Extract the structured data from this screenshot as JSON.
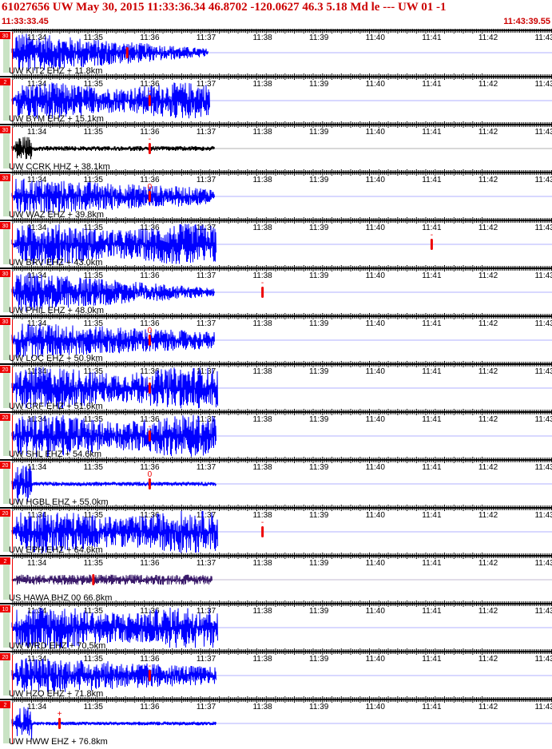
{
  "header": {
    "title": "61027656 UW May 30, 2015 11:33:36.34   46.8702 -120.0627 46.3 5.18 Md le --- UW 01  -1",
    "start_time": "11:33:33.45",
    "end_time": "11:43:39.55"
  },
  "colors": {
    "text": "#cc0000",
    "trace": "#0000ff",
    "trace_dark": "#000000",
    "trace_purple": "#3a1a6a",
    "pick": "#ee0000",
    "axis": "#000000",
    "grid_label": "#000000",
    "band": "#c9e3c4"
  },
  "chart_data": {
    "type": "seismogram",
    "time_range": [
      "11:33:33.45",
      "11:43:39.55"
    ],
    "time_tick_labels": [
      "11:34",
      "11:35",
      "11:36",
      "11:37",
      "11:38",
      "11:39",
      "11:40",
      "11:41",
      "11:42",
      "11:43"
    ],
    "traces": [
      {
        "label": "UW KIT2 EHZ + 11.8km",
        "scale": "30",
        "color": "blue",
        "signal_end": "11:37",
        "pick_time": "11:35.6",
        "pick_mark": ""
      },
      {
        "label": "UW BYM EHZ + 15.1km",
        "scale": "2",
        "color": "blue",
        "signal_end": "11:37",
        "pick_time": "11:36",
        "pick_mark": "-"
      },
      {
        "label": "UW CCRK HHZ + 38.1km",
        "scale": "30",
        "color": "black",
        "signal_end": "11:37",
        "pick_time": "11:36",
        "pick_mark": "-"
      },
      {
        "label": "UW WAZ EHZ + 39.8km",
        "scale": "30",
        "color": "blue",
        "signal_end": "11:37",
        "pick_time": "11:36",
        "pick_mark": "0"
      },
      {
        "label": "UW BRV EHZ + 43.0km",
        "scale": "30",
        "color": "blue",
        "signal_end": "11:37",
        "pick_time": "11:41",
        "pick_mark": "-"
      },
      {
        "label": "UW PHIL EHZ + 48.0km",
        "scale": "30",
        "color": "blue",
        "signal_end": "11:37",
        "pick_time": "11:38",
        "pick_mark": "-"
      },
      {
        "label": "UW LOC EHZ + 50.9km",
        "scale": "30",
        "color": "blue",
        "signal_end": "11:37",
        "pick_time": "11:36",
        "pick_mark": "0"
      },
      {
        "label": "UW CRF EHZ + 51.6km",
        "scale": "20",
        "color": "blue",
        "signal_end": "11:37",
        "pick_time": "11:36",
        "pick_mark": "-"
      },
      {
        "label": "UW SHL EHZ + 54.6km",
        "scale": "20",
        "color": "blue",
        "signal_end": "11:37",
        "pick_time": "11:36",
        "pick_mark": "-"
      },
      {
        "label": "UW HGBL EHZ + 55.0km",
        "scale": "20",
        "color": "blue",
        "signal_end": "11:37",
        "pick_time": "11:36",
        "pick_mark": "0"
      },
      {
        "label": "UW EPH EHZ + 64.6km",
        "scale": "20",
        "color": "blue",
        "signal_end": "11:37",
        "pick_time": "11:38",
        "pick_mark": "-"
      },
      {
        "label": "US HAWA BHZ 00 66.8km",
        "scale": "2",
        "color": "purple",
        "signal_end": "11:37",
        "pick_time": "11:35",
        "pick_mark": ""
      },
      {
        "label": "UW WRD EHZ + 70.5km",
        "scale": "10",
        "color": "blue",
        "signal_end": "11:37",
        "pick_time": "",
        "pick_mark": ""
      },
      {
        "label": "UW HZO EHZ + 71.8km",
        "scale": "20",
        "color": "blue",
        "signal_end": "11:37",
        "pick_time": "11:36",
        "pick_mark": "-"
      },
      {
        "label": "UW HWW EHZ + 76.8km",
        "scale": "2",
        "color": "blue",
        "signal_end": "11:37",
        "pick_time": "11:34.4",
        "pick_mark": "+"
      }
    ]
  }
}
